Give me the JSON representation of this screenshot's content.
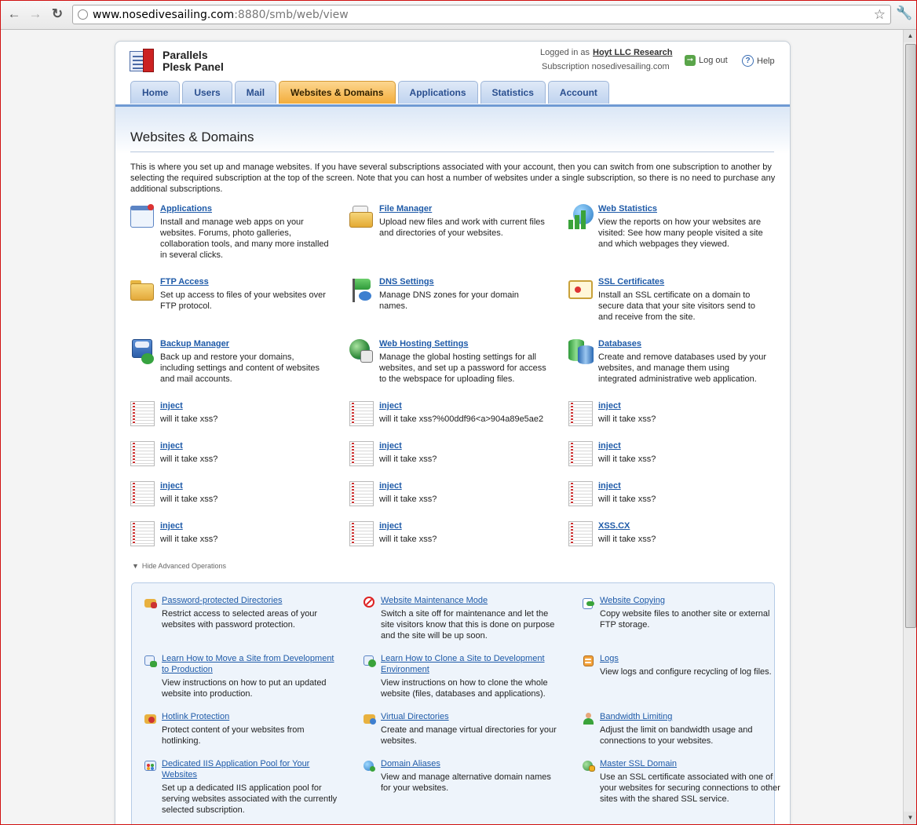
{
  "browser": {
    "url_host": "www.nosedivesailing.com",
    "url_rest": ":8880/smb/web/view"
  },
  "header": {
    "brand_line1": "Parallels",
    "brand_line2": "Plesk Panel",
    "logged_in_label": "Logged in as",
    "user_name": "Hoyt LLC Research",
    "subscription_text": "Subscription nosedivesailing.com",
    "logout_label": "Log out",
    "help_label": "Help"
  },
  "tabs": [
    {
      "label": "Home"
    },
    {
      "label": "Users"
    },
    {
      "label": "Mail"
    },
    {
      "label": "Websites & Domains"
    },
    {
      "label": "Applications"
    },
    {
      "label": "Statistics"
    },
    {
      "label": "Account"
    }
  ],
  "main": {
    "title": "Websites & Domains",
    "intro": "This is where you set up and manage websites. If you have several subscriptions associated with your account, then you can switch from one subscription to another by selecting the required subscription at the top of the screen. Note that you can host a number of websites under a single subscription, so there is no need to purchase any additional subscriptions.",
    "tools": [
      {
        "label": "Applications",
        "desc": "Install and manage web apps on your websites. Forums, photo galleries, collaboration tools, and many more installed in several clicks.",
        "icon": "applications-icon"
      },
      {
        "label": "File Manager",
        "desc": "Upload new files and work with current files and directories of your websites.",
        "icon": "file-manager-icon"
      },
      {
        "label": "Web Statistics",
        "desc": "View the reports on how your websites are visited: See how many people visited a site and which webpages they viewed.",
        "icon": "web-statistics-icon"
      },
      {
        "label": "FTP Access",
        "desc": "Set up access to files of your websites over FTP protocol.",
        "icon": "ftp-folder-icon"
      },
      {
        "label": "DNS Settings",
        "desc": "Manage DNS zones for your domain names.",
        "icon": "dns-flag-icon"
      },
      {
        "label": "SSL Certificates",
        "desc": "Install an SSL certificate on a domain to secure data that your site visitors send to and receive from the site.",
        "icon": "certificate-icon"
      },
      {
        "label": "Backup Manager",
        "desc": "Back up and restore your domains, including settings and content of websites and mail accounts.",
        "icon": "backup-icon"
      },
      {
        "label": "Web Hosting Settings",
        "desc": "Manage the global hosting settings for all websites, and set up a password for access to the webspace for uploading files.",
        "icon": "hosting-globe-icon"
      },
      {
        "label": "Databases",
        "desc": "Create and remove databases used by your websites, and manage them using integrated administrative web application.",
        "icon": "database-icon"
      }
    ],
    "custom": [
      {
        "label": "inject",
        "desc": "will it take xss?"
      },
      {
        "label": "inject",
        "desc": "will it take xss?%00ddf96<a>904a89e5ae2"
      },
      {
        "label": "inject",
        "desc": "will it take xss?"
      },
      {
        "label": "inject",
        "desc": "will it take xss?"
      },
      {
        "label": "inject",
        "desc": "will it take xss?"
      },
      {
        "label": "inject",
        "desc": "will it take xss?"
      },
      {
        "label": "inject",
        "desc": "will it take xss?"
      },
      {
        "label": "inject",
        "desc": "will it take xss?"
      },
      {
        "label": "inject",
        "desc": "will it take xss?"
      },
      {
        "label": "inject",
        "desc": "will it take xss?"
      },
      {
        "label": "inject",
        "desc": "will it take xss?"
      },
      {
        "label": "XSS.CX",
        "desc": "will it take xss?"
      }
    ],
    "advanced_toggle": "Hide Advanced Operations",
    "advanced": [
      {
        "label": "Password-protected Directories",
        "desc": "Restrict access to selected areas of your websites with password protection.",
        "icon": "lock-folder-icon"
      },
      {
        "label": "Website Maintenance Mode",
        "desc": "Switch a site off for maintenance and let the site visitors know that this is done on purpose and the site will be up soon.",
        "icon": "no-entry-icon"
      },
      {
        "label": "Website Copying",
        "desc": "Copy website files to another site or external FTP storage.",
        "icon": "copy-icon"
      },
      {
        "label": "Learn How to Move a Site from Development to Production",
        "desc": "View instructions on how to put an updated website into production.",
        "icon": "move-site-icon"
      },
      {
        "label": "Learn How to Clone a Site to Development Environment",
        "desc": "View instructions on how to clone the whole website (files, databases and applications).",
        "icon": "clone-site-icon"
      },
      {
        "label": "Logs",
        "desc": "View logs and configure recycling of log files.",
        "icon": "logs-icon"
      },
      {
        "label": "Hotlink Protection",
        "desc": "Protect content of your websites from hotlinking.",
        "icon": "hotlink-icon"
      },
      {
        "label": "Virtual Directories",
        "desc": "Create and manage virtual directories for your websites.",
        "icon": "virtual-directory-icon"
      },
      {
        "label": "Bandwidth Limiting",
        "desc": "Adjust the limit on bandwidth usage and connections to your websites.",
        "icon": "bandwidth-icon"
      },
      {
        "label": "Dedicated IIS Application Pool for Your Websites",
        "desc": "Set up a dedicated IIS application pool for serving websites associated with the currently selected subscription.",
        "icon": "app-pool-icon"
      },
      {
        "label": "Domain Aliases",
        "desc": "View and manage alternative domain names for your websites.",
        "icon": "domain-alias-icon"
      },
      {
        "label": "Master SSL Domain",
        "desc": "Use an SSL certificate associated with one of your websites for securing connections to other sites with the shared SSL service.",
        "icon": "master-ssl-icon"
      }
    ]
  }
}
